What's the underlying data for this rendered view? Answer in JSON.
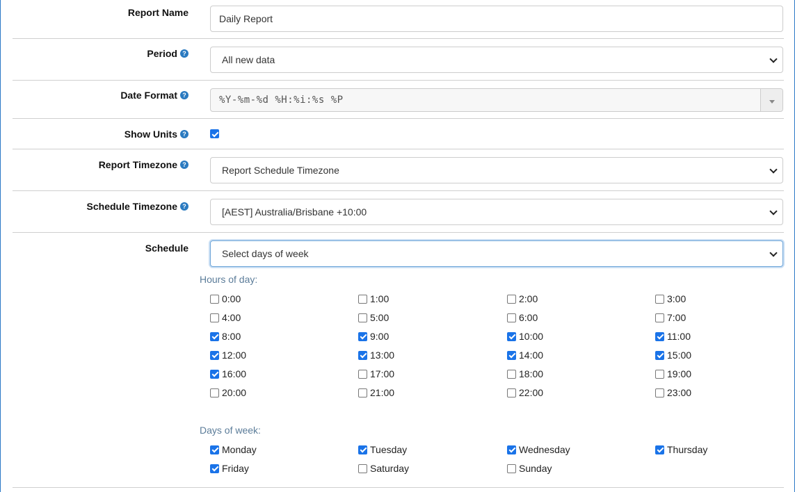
{
  "form": {
    "report_name": {
      "label": "Report Name",
      "value": "Daily Report"
    },
    "period": {
      "label": "Period",
      "value": "All new data"
    },
    "date_format": {
      "label": "Date Format",
      "value": "%Y-%m-%d %H:%i:%s %P"
    },
    "show_units": {
      "label": "Show Units",
      "checked": true
    },
    "report_timezone": {
      "label": "Report Timezone",
      "value": "Report Schedule Timezone"
    },
    "schedule_timezone": {
      "label": "Schedule Timezone",
      "value": "[AEST] Australia/Brisbane +10:00"
    },
    "schedule": {
      "label": "Schedule",
      "value": "Select days of week"
    }
  },
  "hours": {
    "title": "Hours of day:",
    "items": [
      {
        "label": "0:00",
        "checked": false
      },
      {
        "label": "1:00",
        "checked": false
      },
      {
        "label": "2:00",
        "checked": false
      },
      {
        "label": "3:00",
        "checked": false
      },
      {
        "label": "4:00",
        "checked": false
      },
      {
        "label": "5:00",
        "checked": false
      },
      {
        "label": "6:00",
        "checked": false
      },
      {
        "label": "7:00",
        "checked": false
      },
      {
        "label": "8:00",
        "checked": true
      },
      {
        "label": "9:00",
        "checked": true
      },
      {
        "label": "10:00",
        "checked": true
      },
      {
        "label": "11:00",
        "checked": true
      },
      {
        "label": "12:00",
        "checked": true
      },
      {
        "label": "13:00",
        "checked": true
      },
      {
        "label": "14:00",
        "checked": true
      },
      {
        "label": "15:00",
        "checked": true
      },
      {
        "label": "16:00",
        "checked": true
      },
      {
        "label": "17:00",
        "checked": false
      },
      {
        "label": "18:00",
        "checked": false
      },
      {
        "label": "19:00",
        "checked": false
      },
      {
        "label": "20:00",
        "checked": false
      },
      {
        "label": "21:00",
        "checked": false
      },
      {
        "label": "22:00",
        "checked": false
      },
      {
        "label": "23:00",
        "checked": false
      }
    ]
  },
  "days": {
    "title": "Days of week:",
    "items": [
      {
        "label": "Monday",
        "checked": true
      },
      {
        "label": "Tuesday",
        "checked": true
      },
      {
        "label": "Wednesday",
        "checked": true
      },
      {
        "label": "Thursday",
        "checked": true
      },
      {
        "label": "Friday",
        "checked": true
      },
      {
        "label": "Saturday",
        "checked": false
      },
      {
        "label": "Sunday",
        "checked": false
      }
    ]
  },
  "icons": {
    "help": "?"
  },
  "colors": {
    "accent": "#1a73e8",
    "help_icon": "#2a7ac0",
    "section_title": "#5b7c99",
    "frame_border": "#2b78c6"
  }
}
